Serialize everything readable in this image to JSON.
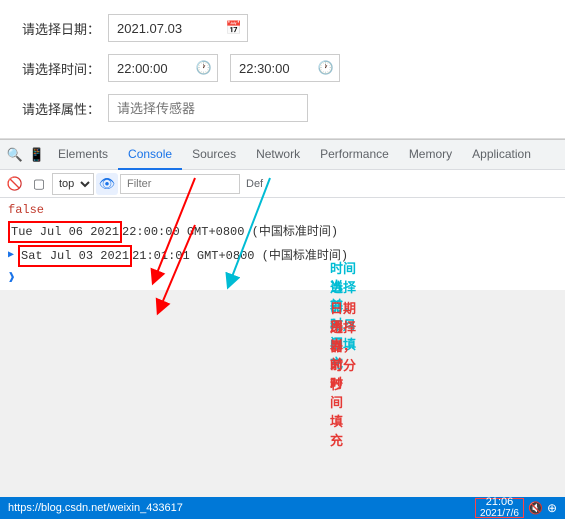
{
  "form": {
    "date_label": "请选择日期：",
    "date_value": "2021.07.03",
    "time_label": "请选择时间：",
    "time_start": "22:00:00",
    "time_end": "22:30:00",
    "sensor_label": "请选择属性：",
    "sensor_placeholder": "请选择传感器"
  },
  "devtools": {
    "tabs": [
      "Elements",
      "Console",
      "Sources",
      "Network",
      "Performance",
      "Memory",
      "Application"
    ],
    "active_tab": "Console",
    "top_value": "top",
    "filter_placeholder": "Filter",
    "def_label": "Def"
  },
  "console": {
    "line1": "false",
    "line2": "Tue Jul 06 2021 22:00:00 GMT+0800 (中国标准时间)",
    "line2_highlight": "Tue Jul 06 2021",
    "line3_highlight": "Sat Jul 03 2021",
    "line3": "Sat Jul 03 2021 21:01:01 GMT+0800 (中国标准时间)"
  },
  "annotations": {
    "text1": "时间选择器，年月日填充",
    "text2": "当前时间",
    "text3": "日期选择器，时分秒",
    "text4": "用当前时间填充"
  },
  "status_bar": {
    "url": "https://blog.csdn.net/weixin_433617",
    "time": "21:06",
    "date": "2021/7/6",
    "icons": "🔇 ⊕"
  }
}
